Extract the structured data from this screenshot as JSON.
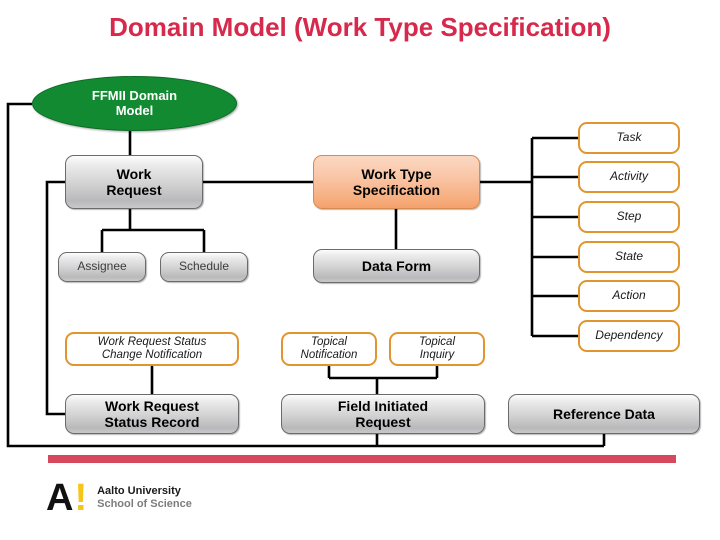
{
  "slide": {
    "title": "Domain Model (Work Type Specification)"
  },
  "root": {
    "label": "FFMII Domain\nModel",
    "shape": "ellipse",
    "fill": "#128a32",
    "text_color": "#ffffff"
  },
  "nodes": {
    "work_request": "Work\nRequest",
    "work_type_specification": "Work Type\nSpecification",
    "assignee": "Assignee",
    "schedule": "Schedule",
    "data_form": "Data Form",
    "work_request_status_change_notification": "Work Request Status\nChange Notification",
    "work_request_status_record": "Work Request\nStatus Record",
    "topical_notification": "Topical\nNotification",
    "topical_inquiry": "Topical\nInquiry",
    "field_initiated_request": "Field Initiated\nRequest",
    "reference_data": "Reference Data"
  },
  "work_type_children": [
    {
      "label": "Task"
    },
    {
      "label": "Activity"
    },
    {
      "label": "Step"
    },
    {
      "label": "State"
    },
    {
      "label": "Action"
    },
    {
      "label": "Dependency"
    }
  ],
  "footer": {
    "logo_mark": "A",
    "logo_bang": "!",
    "line1": "Aalto University",
    "line2": "School of Science"
  },
  "colors": {
    "title": "#d6294b",
    "accent_red_bar": "#d6495c",
    "green": "#128a32",
    "peach": "#f6a976",
    "orange_outline": "#e0952f",
    "logo_yellow": "#f5c518",
    "connector": "#000000"
  }
}
